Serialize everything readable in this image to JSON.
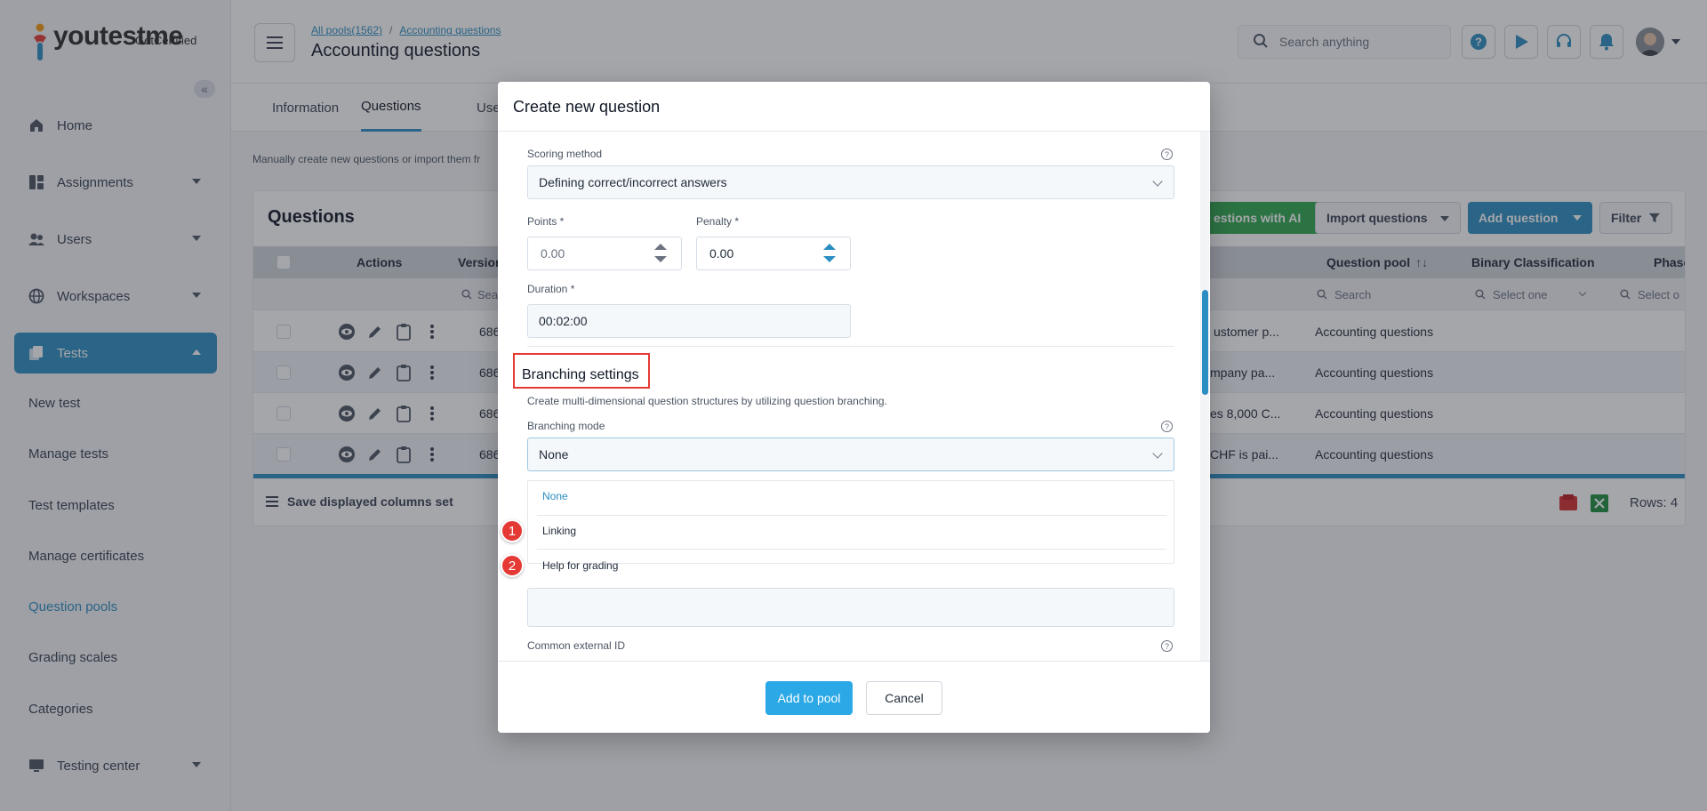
{
  "brand": {
    "name": "youtestme",
    "sub": "GetCertified"
  },
  "sidebar": {
    "items": [
      {
        "label": "Home",
        "icon": "home-icon"
      },
      {
        "label": "Assignments",
        "icon": "assignments-icon"
      },
      {
        "label": "Users",
        "icon": "users-icon"
      },
      {
        "label": "Workspaces",
        "icon": "globe-icon"
      },
      {
        "label": "Tests",
        "icon": "tests-icon"
      }
    ],
    "sub_items": [
      "New test",
      "Manage tests",
      "Test templates",
      "Manage certificates",
      "Question pools",
      "Grading scales",
      "Categories"
    ],
    "testing_center": "Testing center"
  },
  "header": {
    "breadcrumb": [
      "All pools(1562)",
      "Accounting questions"
    ],
    "breadcrumb_sep": "/",
    "title": "Accounting questions",
    "search_placeholder": "Search anything"
  },
  "tabs": [
    "Information",
    "Questions",
    "Use"
  ],
  "description": "Manually create new questions or import them fr",
  "questions": {
    "title": "Questions",
    "buttons": {
      "ai": "estions with AI",
      "import": "Import questions",
      "add": "Add question",
      "filter": "Filter"
    },
    "columns": {
      "actions": "Actions",
      "version": "Version",
      "pool": "Question pool",
      "pool_sort": "↑↓",
      "binary": "Binary Classification",
      "phase": "Phase"
    },
    "filters": {
      "version": "Sea",
      "pool": "Search",
      "binary": "Select one",
      "phase": "Select o"
    },
    "rows": [
      {
        "version": "686",
        "text": "ustomer p...",
        "pool": "Accounting questions"
      },
      {
        "version": "686",
        "text": "mpany pa...",
        "pool": "Accounting questions"
      },
      {
        "version": "686",
        "text": "es 8,000 C...",
        "pool": "Accounting questions"
      },
      {
        "version": "686",
        "text": "CHF is pai...",
        "pool": "Accounting questions"
      }
    ],
    "save_columns": "Save displayed columns set",
    "rows_count": "Rows: 4"
  },
  "modal": {
    "title": "Create new question",
    "scoring_label": "Scoring method",
    "scoring_value": "Defining correct/incorrect answers",
    "points_label": "Points *",
    "points_value": "0.00",
    "penalty_label": "Penalty *",
    "penalty_value": "0.00",
    "duration_label": "Duration *",
    "duration_value": "00:02:00",
    "branching_title": "Branching settings",
    "branching_desc": "Create multi-dimensional question structures by utilizing question branching.",
    "branching_mode_label": "Branching mode",
    "branching_mode_value": "None",
    "options": [
      "None",
      "Linking",
      "Help for grading"
    ],
    "badges": [
      "1",
      "2"
    ],
    "external_id_label": "Common external ID",
    "help_glyph": "?",
    "add_button": "Add to pool",
    "cancel_button": "Cancel"
  },
  "colors": {
    "accent": "#2b8dc1",
    "primary_button": "#2ba9e6",
    "highlight": "#e53935",
    "ai_button": "#2fa84f"
  }
}
